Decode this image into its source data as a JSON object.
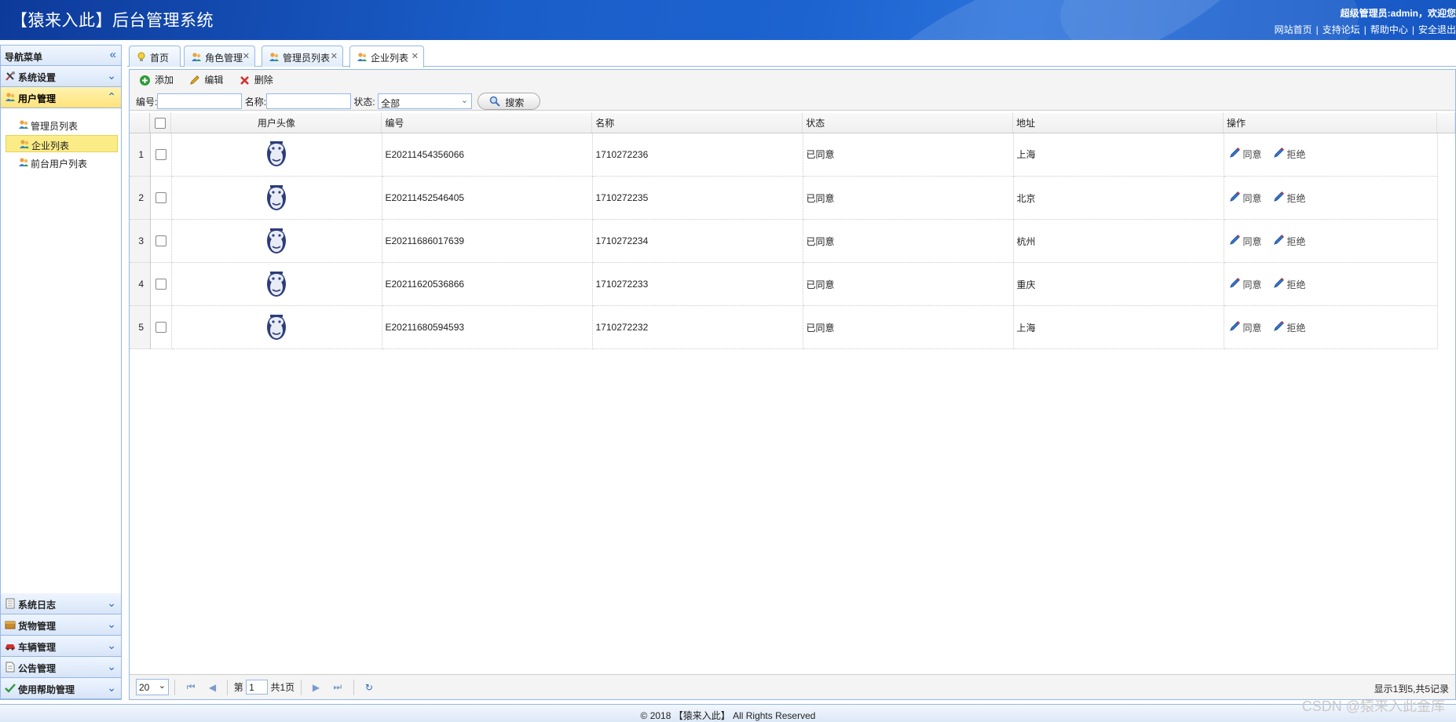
{
  "header": {
    "title": "【猿来入此】后台管理系统",
    "user_text": "超级管理员:admin，欢迎您",
    "links": [
      "网站首页",
      "支持论坛",
      "帮助中心",
      "安全退出"
    ]
  },
  "sidebar": {
    "title": "导航菜单",
    "top_panels": [
      {
        "label": "系统设置",
        "icon": "settings-tools-icon"
      },
      {
        "label": "用户管理",
        "icon": "users-icon"
      }
    ],
    "sub_items": [
      "管理员列表",
      "企业列表",
      "前台用户列表"
    ],
    "selected_sub_item": "企业列表",
    "bottom_panels": [
      {
        "label": "系统日志",
        "icon": "log-icon"
      },
      {
        "label": "货物管理",
        "icon": "box-icon"
      },
      {
        "label": "车辆管理",
        "icon": "car-icon"
      },
      {
        "label": "公告管理",
        "icon": "notice-icon"
      },
      {
        "label": "使用帮助管理",
        "icon": "check-icon"
      }
    ]
  },
  "tabs": [
    {
      "label": "首页",
      "closable": false
    },
    {
      "label": "角色管理",
      "closable": true
    },
    {
      "label": "管理员列表",
      "closable": true
    },
    {
      "label": "企业列表",
      "closable": true,
      "active": true
    }
  ],
  "toolbar": {
    "add_label": "添加",
    "edit_label": "编辑",
    "delete_label": "删除"
  },
  "search": {
    "code_label": "编号:",
    "name_label": "名称:",
    "status_label": "状态:",
    "status_value": "全部",
    "button_label": "搜索"
  },
  "grid": {
    "columns": [
      "用户头像",
      "编号",
      "名称",
      "状态",
      "地址",
      "操作"
    ],
    "rows": [
      {
        "num": "1",
        "code": "E20211454356066",
        "name": "1710272236",
        "status": "已同意",
        "address": "上海"
      },
      {
        "num": "2",
        "code": "E20211452546405",
        "name": "1710272235",
        "status": "已同意",
        "address": "北京"
      },
      {
        "num": "3",
        "code": "E20211686017639",
        "name": "1710272234",
        "status": "已同意",
        "address": "杭州"
      },
      {
        "num": "4",
        "code": "E20211620536866",
        "name": "1710272233",
        "status": "已同意",
        "address": "重庆"
      },
      {
        "num": "5",
        "code": "E20211680594593",
        "name": "1710272232",
        "status": "已同意",
        "address": "上海"
      }
    ],
    "action_agree": "同意",
    "action_reject": "拒绝"
  },
  "pager": {
    "page_size": "20",
    "page_prefix": "第",
    "page_value": "1",
    "page_total": "共1页",
    "info": "显示1到5,共5记录"
  },
  "footer": {
    "text": "© 2018 【猿来入此】 All Rights Reserved"
  },
  "watermark": "CSDN @猿来入此金库"
}
